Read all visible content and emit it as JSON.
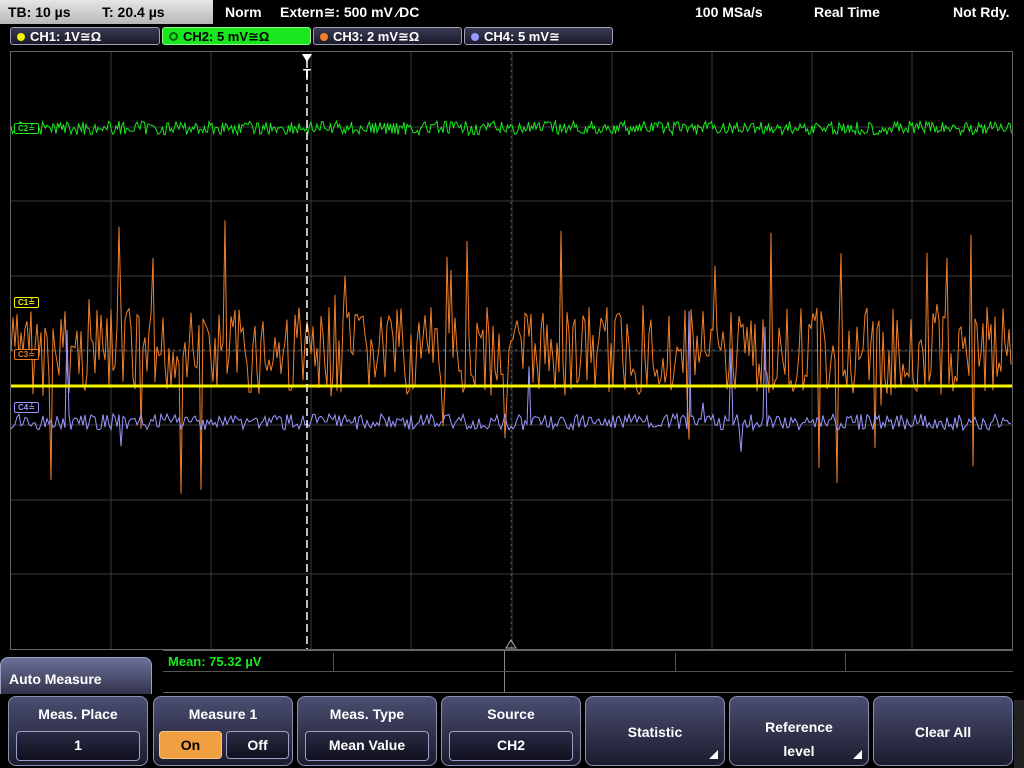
{
  "status": {
    "timebase": "TB: 10 µs",
    "trigger_time": "T: 20.4 µs",
    "mode": "Norm",
    "trigger_source": "Extern≅: 500 mV ⁄DC",
    "sample_rate": "100 MSa/s",
    "acq_mode": "Real Time",
    "state": "Not Rdy."
  },
  "channels": [
    {
      "name": "ch1",
      "label": "CH1: 1V≅Ω",
      "color": "#f5f500"
    },
    {
      "name": "ch2",
      "label": "CH2: 5 mV≅Ω",
      "color": "#19e81e"
    },
    {
      "name": "ch3",
      "label": "CH3: 2 mV≅Ω",
      "color": "#f07f2a"
    },
    {
      "name": "ch4",
      "label": "CH4: 5 mV≅",
      "color": "#9a98ff"
    }
  ],
  "markers": {
    "c1": "C1≟",
    "c2": "C2≟",
    "c3": "C3≟",
    "c4": "C4≟",
    "trigger": "T"
  },
  "measurement": {
    "result": "Mean: 75.32 µV"
  },
  "menu": {
    "title": "Auto Measure",
    "softkeys": {
      "meas_place_title": "Meas. Place",
      "meas_place_value": "1",
      "measure1_title": "Measure 1",
      "on_label": "On",
      "off_label": "Off",
      "meas_type_title": "Meas. Type",
      "meas_type_value": "Mean Value",
      "source_title": "Source",
      "source_value": "CH2",
      "statistic": "Statistic",
      "reference_line1": "Reference",
      "reference_line2": "level",
      "clear_all": "Clear All"
    }
  }
}
